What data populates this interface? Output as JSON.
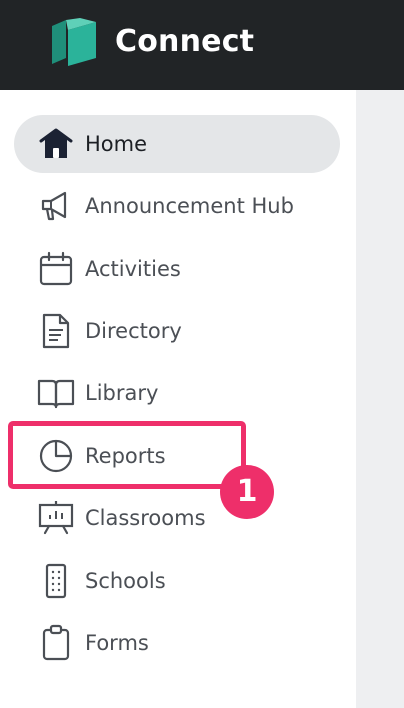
{
  "header": {
    "brand": "Connect",
    "logo_icon": "connect-logo-icon",
    "background": "#212426",
    "logo_color": "#2bb39a"
  },
  "sidebar": {
    "items": [
      {
        "label": "Home",
        "icon": "home-icon",
        "active": true
      },
      {
        "label": "Announcement Hub",
        "icon": "megaphone-icon",
        "active": false
      },
      {
        "label": "Activities",
        "icon": "calendar-icon",
        "active": false
      },
      {
        "label": "Directory",
        "icon": "document-icon",
        "active": false
      },
      {
        "label": "Library",
        "icon": "book-icon",
        "active": false
      },
      {
        "label": "Reports",
        "icon": "pie-chart-icon",
        "active": false
      },
      {
        "label": "Classrooms",
        "icon": "presentation-board-icon",
        "active": false
      },
      {
        "label": "Schools",
        "icon": "building-icon",
        "active": false
      },
      {
        "label": "Forms",
        "icon": "clipboard-icon",
        "active": false
      }
    ]
  },
  "annotation": {
    "step_number": "1",
    "highlight_color": "#ee2f6a"
  }
}
